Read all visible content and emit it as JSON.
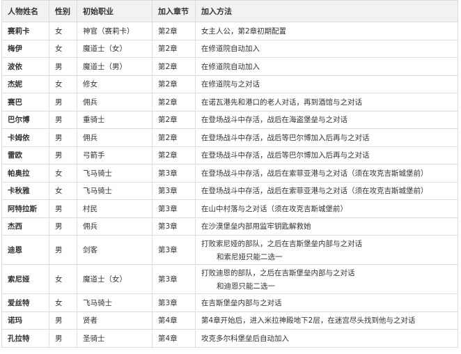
{
  "headers": [
    "人物姓名",
    "性别",
    "初始职业",
    "加入章节",
    "加入方法"
  ],
  "rows": [
    {
      "name": "赛莉卡",
      "gender": "女",
      "job": "神官（赛莉卡）",
      "chapter": "第2章",
      "method": [
        "女主人公，第2章初期配置"
      ]
    },
    {
      "name": "梅伊",
      "gender": "女",
      "job": "魔道士（女）",
      "chapter": "第2章",
      "method": [
        "在修道院自动加入"
      ]
    },
    {
      "name": "波依",
      "gender": "男",
      "job": "魔道士（男）",
      "chapter": "第2章",
      "method": [
        "在修道院自动加入"
      ]
    },
    {
      "name": "杰妮",
      "gender": "女",
      "job": "修女",
      "chapter": "第2章",
      "method": [
        "在修道院与之对话"
      ]
    },
    {
      "name": "赛巴",
      "gender": "男",
      "job": "佣兵",
      "chapter": "第2章",
      "method": [
        "在诺瓦港先和港口的老人对话，再到酒馆与之对话"
      ]
    },
    {
      "name": "巴尔博",
      "gender": "男",
      "job": "重骑士",
      "chapter": "第2章",
      "method": [
        "在登场战斗中存活，战后在海盗堡垒与之对话"
      ]
    },
    {
      "name": "卡姆依",
      "gender": "男",
      "job": "佣兵",
      "chapter": "第2章",
      "method": [
        "在登场战斗中存活，战后等巴尔博加入后再与之对话"
      ]
    },
    {
      "name": "雷欧",
      "gender": "男",
      "job": "弓箭手",
      "chapter": "第2章",
      "method": [
        "在登场战斗中存活，战后等巴尔博加入后再与之对话"
      ]
    },
    {
      "name": "帕奥拉",
      "gender": "女",
      "job": "飞马骑士",
      "chapter": "第3章",
      "method": [
        "在登场战斗中存活，战后在索菲亚港与之对话（须在攻克吉斯城堡前）"
      ]
    },
    {
      "name": "卡秋雅",
      "gender": "女",
      "job": "飞马骑士",
      "chapter": "第3章",
      "method": [
        "在登场战斗中存活，战后在索菲亚港与之对话（须在攻克吉斯城堡前）"
      ]
    },
    {
      "name": "阿特拉斯",
      "gender": "男",
      "job": "村民",
      "chapter": "第3章",
      "method": [
        "在山中村落与之对话（须在攻克吉斯城堡前）"
      ]
    },
    {
      "name": "杰西",
      "gender": "男",
      "job": "佣兵",
      "chapter": "第3章",
      "method": [
        "在沙漠堡垒内部用监牢钥匙解救她"
      ]
    },
    {
      "name": "迪恩",
      "gender": "男",
      "job": "剑客",
      "chapter": "第3章",
      "method": [
        "打败索尼娅的部队，之后在吉斯堡垒内部与之对话",
        "和索尼娅只能二选一"
      ]
    },
    {
      "name": "索尼娅",
      "gender": "女",
      "job": "魔道士（女）",
      "chapter": "第3章",
      "method": [
        "打败迪恩的部队，之后在吉斯堡垒内部与之对话",
        "和迪恩只能二选一"
      ]
    },
    {
      "name": "爱丝特",
      "gender": "女",
      "job": "飞马骑士",
      "chapter": "第3章",
      "method": [
        "在吉斯堡垒内部与之对话"
      ]
    },
    {
      "name": "诺玛",
      "gender": "男",
      "job": "贤者",
      "chapter": "第4章",
      "method": [
        "第4章开始后，进入米拉神殿地下2层，在迷宫尽头找到他与之对话"
      ]
    },
    {
      "name": "孔拉特",
      "gender": "男",
      "job": "圣骑士",
      "chapter": "第4章",
      "method": [
        "攻克多尔科堡垒后自动加入"
      ]
    }
  ]
}
